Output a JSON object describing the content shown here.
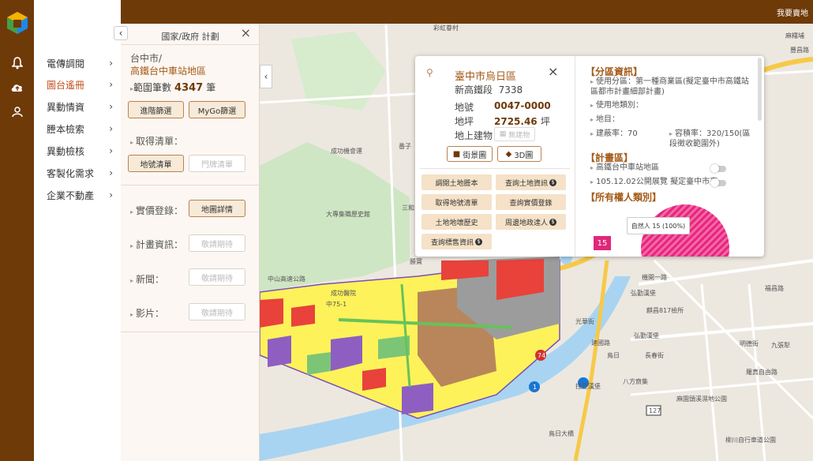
{
  "colors": {
    "brand": "#6e3a08",
    "accent": "#c0501f",
    "pie": "#e8247f"
  },
  "rail": {
    "icons": [
      "cube-logo-icon",
      "bell-icon",
      "cloud-upload-icon",
      "user-icon"
    ]
  },
  "topbar": {
    "right_link": "我要賣地"
  },
  "nav": {
    "items": [
      {
        "label": "電傳調閱",
        "active": false
      },
      {
        "label": "圖台遙冊",
        "active": true
      },
      {
        "label": "異動情資",
        "active": false
      },
      {
        "label": "謄本檢索",
        "active": false
      },
      {
        "label": "異動檢核",
        "active": false
      },
      {
        "label": "客製化需求",
        "active": false
      },
      {
        "label": "企業不動產",
        "active": false
      }
    ]
  },
  "panel": {
    "title": "國家/政府 計劃",
    "location_city": "台中市/",
    "location_area": "高鐵台中車站地區",
    "range_label": "範圍筆數",
    "range_count": "4347",
    "range_unit": "筆",
    "btn_advanced": "進階篩選",
    "btn_mygo": "MyGo篩選",
    "list_label": "取得清單：",
    "btn_lot_list": "地號清單",
    "btn_door_list": "門牌清單",
    "price_label": "實價登錄：",
    "btn_map_detail": "地圖詳情",
    "plan_label": "計畫資訊：",
    "news_label": "新聞：",
    "video_label": "影片：",
    "coming_soon": "敬請期待"
  },
  "popup": {
    "district": "臺中市烏日區",
    "section_name": "新高鐵段",
    "section_no": "7338",
    "lot_label": "地號",
    "lot_value": "0047-0000",
    "area_label": "地坪",
    "area_value": "2725.46",
    "area_unit": "坪",
    "building_label": "地上建物",
    "no_building": "無建物",
    "btn_street": "街景圖",
    "btn_3d": "3D圖",
    "actions": [
      {
        "label": "調閱土地謄本",
        "badge": ""
      },
      {
        "label": "查詢土地資訊",
        "badge": "$"
      },
      {
        "label": "取得地號清單",
        "badge": ""
      },
      {
        "label": "查詢實價登錄",
        "badge": ""
      },
      {
        "label": "土地地壞歷史",
        "badge": ""
      },
      {
        "label": "周邊地政達人",
        "badge": "$"
      },
      {
        "label": "查詢標售資訊",
        "badge": "$"
      }
    ],
    "zoning_head": "【分區資訊】",
    "zoning_use": "使用分區：第一種商業區(擬定臺中市高鐵站區都市計畫細部計畫)",
    "zoning_land_cat": "使用地類別：",
    "zoning_plot": "地目：",
    "coverage": "建蔽率：70",
    "far": "容積率：320/150(區段徵收範圍外)",
    "plan_head": "【計畫區】",
    "plan_1": "高鐵台中車站地區",
    "plan_2": "105.12.02公開展覽 擬定臺中市高...",
    "owner_head": "【所有權人類別】",
    "owner_tooltip": "自然人 15 (100%)",
    "owner_count": "15"
  },
  "map_labels": {
    "a": "成功機會運",
    "b": "大專集職歷史館",
    "c": "成功醫院",
    "d": "中山高速公路",
    "e": "中75-1",
    "f": "三和",
    "g": "番子",
    "h": "弘勤漢堡",
    "i": "九張犁",
    "j": "鳥日",
    "k": "長春街",
    "l": "建國路",
    "m": "光華街",
    "n": "麻園頭溪濕地公園",
    "o": "柳川自行車道公園",
    "p": "鳥日大橋",
    "q": "八方齋集",
    "r": "麻糬埔",
    "s": "豐昌路",
    "t": "彩虹眷村",
    "u": "勝寶",
    "v": "拉亞漢堡",
    "w": "機開一路",
    "x": "明德街",
    "y": "福昌路",
    "z": "弘勤漢堡",
    "aa": "麒昌817檢所",
    "bb": "羅真自由路",
    "road_74": "74",
    "road_1": "1",
    "road_127": "127"
  }
}
